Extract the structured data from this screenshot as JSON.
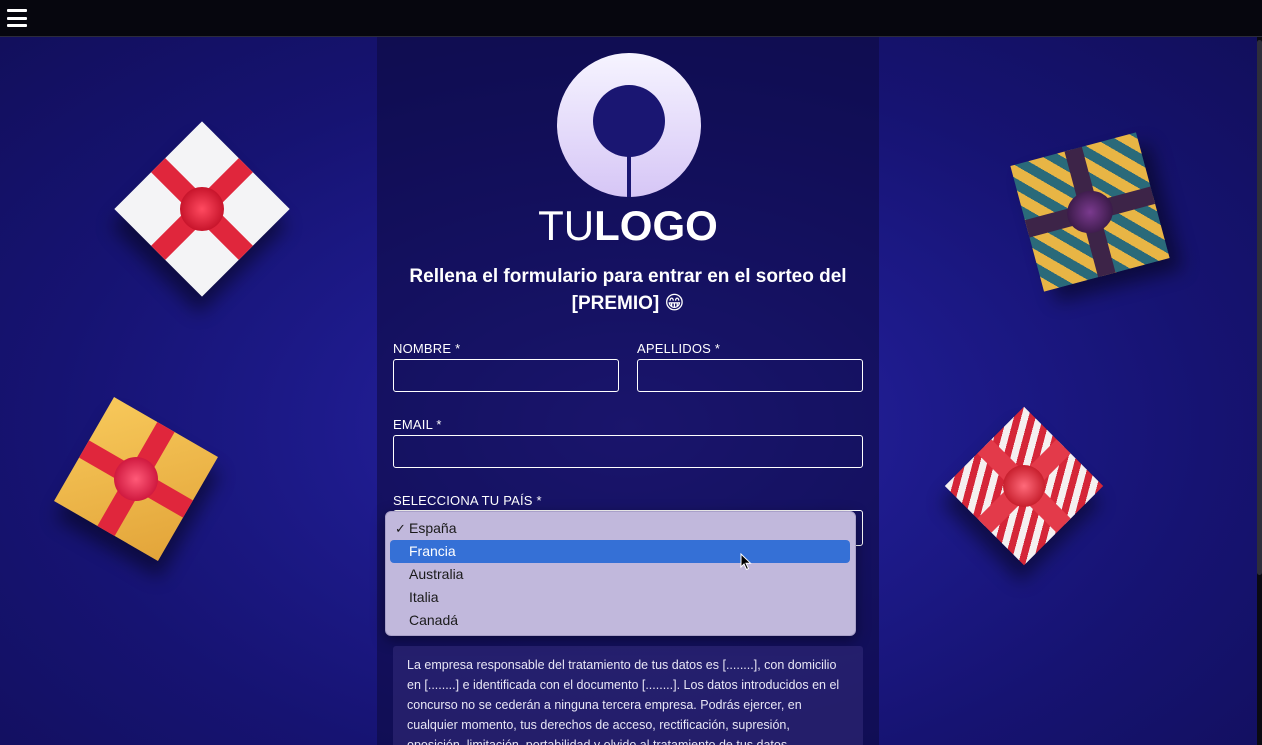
{
  "logo": {
    "text_light": "TU",
    "text_bold": "LOGO"
  },
  "form": {
    "headline": "Rellena el formulario para entrar en el sorteo del [PREMIO] 😁",
    "nombre_label": "NOMBRE *",
    "apellidos_label": "APELLIDOS *",
    "email_label": "EMAIL *",
    "country_label": "SELECCIONA TU PAÍS *",
    "country_selected": "España",
    "country_options": [
      "España",
      "Francia",
      "Australia",
      "Italia",
      "Canadá"
    ],
    "country_hovered": "Francia"
  },
  "legal": {
    "text": "La empresa responsable del tratamiento de tus datos es [........], con domicilio en [........] e identificada con el documento [........]. Los datos introducidos en el concurso no se cederán a ninguna tercera empresa. Podrás ejercer, en cualquier momento, tus derechos de acceso, rectificación, supresión, oposición, limitación, portabilidad y olvido al tratamiento de tus datos."
  },
  "icons": {
    "menu": "hamburger-menu-icon",
    "check": "checkmark-icon",
    "cursor": "mouse-pointer-icon"
  },
  "colors": {
    "background": "#1d1a8a",
    "topbar": "#06060e",
    "dropdown_bg": "#c1b8dc",
    "dropdown_highlight": "#3570d6",
    "logo_gradient_top": "#f4f1ff",
    "logo_gradient_bottom": "#d9c9f5"
  }
}
